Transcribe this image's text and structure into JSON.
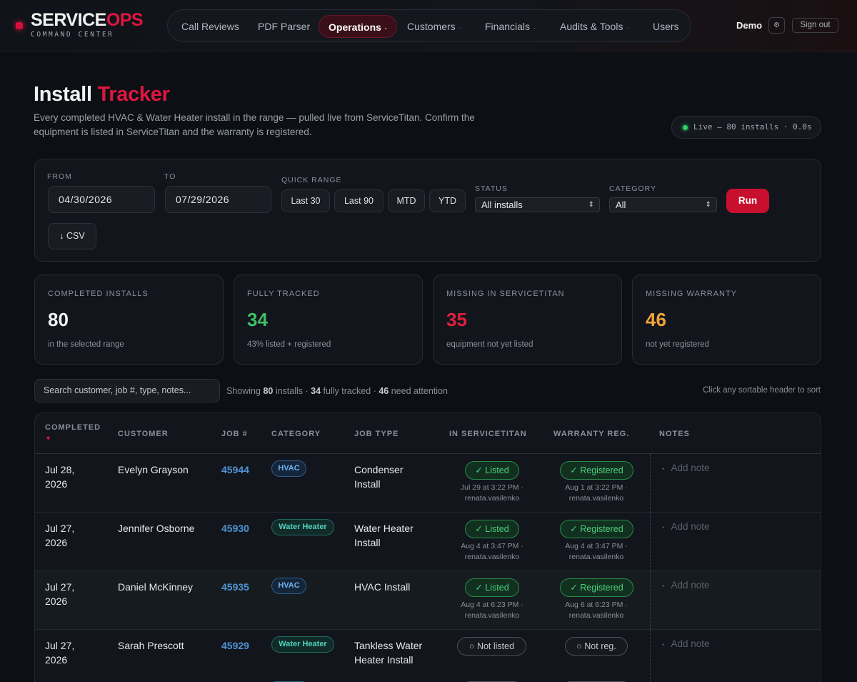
{
  "brand": {
    "name_main": "SERVICE",
    "name_accent": "OPS",
    "subtitle": "COMMAND CENTER"
  },
  "nav": [
    {
      "label": "Call Reviews",
      "caret": ""
    },
    {
      "label": "PDF Parser",
      "caret": ""
    },
    {
      "label": "Operations",
      "caret": "·",
      "active": true
    },
    {
      "label": "Customers",
      "caret": "·"
    },
    {
      "label": "Financials",
      "caret": "·"
    },
    {
      "label": "Audits & Tools",
      "caret": "·"
    },
    {
      "label": "Users",
      "caret": ""
    }
  ],
  "user": {
    "name": "Demo",
    "settings_icon": "⚙",
    "signout_label": "Sign out"
  },
  "page": {
    "title_main": "Install ",
    "title_accent": "Tracker",
    "description": "Every completed HVAC & Water Heater install in the range — pulled live from ServiceTitan. Confirm the equipment is listed in ServiceTitan and the warranty is registered.",
    "live_status": "Live — 80 installs · 0.0s"
  },
  "filters": {
    "from_label": "FROM",
    "from_value": "04/30/2026",
    "to_label": "TO",
    "to_value": "07/29/2026",
    "quick_range_label": "QUICK RANGE",
    "quick_ranges": [
      "Last 30",
      "Last 90",
      "MTD",
      "YTD"
    ],
    "status_label": "STATUS",
    "status_value": "All installs",
    "category_label": "CATEGORY",
    "category_value": "All",
    "run_label": "Run",
    "csv_label": "↓ CSV"
  },
  "stats": [
    {
      "label": "COMPLETED INSTALLS",
      "value": "80",
      "sub": "in the selected range",
      "color": "#f0f1f3"
    },
    {
      "label": "FULLY TRACKED",
      "value": "34",
      "sub": "43% listed + registered",
      "color": "#3fbf68"
    },
    {
      "label": "MISSING IN SERVICETITAN",
      "value": "35",
      "sub": "equipment not yet listed",
      "color": "#e0203f"
    },
    {
      "label": "MISSING WARRANTY",
      "value": "46",
      "sub": "not yet registered",
      "color": "#f0a53a"
    }
  ],
  "search": {
    "placeholder": "Search customer, job #, type, notes..."
  },
  "summary": {
    "prefix": "Showing ",
    "installs": "80",
    "mid1": " installs · ",
    "tracked": "34",
    "mid2": " fully tracked · ",
    "attention": "46",
    "suffix": " need attention"
  },
  "sort_hint": "Click any sortable header to sort",
  "table": {
    "headers": [
      "COMPLETED",
      "CUSTOMER",
      "JOB #",
      "CATEGORY",
      "JOB TYPE",
      "IN SERVICETITAN",
      "WARRANTY REG.",
      "NOTES"
    ],
    "sort_indicator": "▼",
    "add_note_label": "Add note",
    "rows": [
      {
        "date_line1": "Jul 28,",
        "date_line2": "2026",
        "customer": "Evelyn Grayson",
        "job": "45944",
        "category": "HVAC",
        "type_line1": "Condenser",
        "type_line2": "Install",
        "st_label": "✓  Listed",
        "st_ok": true,
        "st_meta1": "Jul 29 at 3:22 PM ·",
        "st_meta2": "renata.vasilenko",
        "wr_label": "✓  Registered",
        "wr_ok": true,
        "wr_meta1": "Aug 1 at 3:22 PM ·",
        "wr_meta2": "renata.vasilenko"
      },
      {
        "date_line1": "Jul 27,",
        "date_line2": "2026",
        "customer": "Jennifer Osborne",
        "job": "45930",
        "category": "Water Heater",
        "type_line1": "Water Heater",
        "type_line2": "Install",
        "st_label": "✓  Listed",
        "st_ok": true,
        "st_meta1": "Aug 4 at 3:47 PM ·",
        "st_meta2": "renata.vasilenko",
        "wr_label": "✓  Registered",
        "wr_ok": true,
        "wr_meta1": "Aug 4 at 3:47 PM ·",
        "wr_meta2": "renata.vasilenko"
      },
      {
        "date_line1": "Jul 27,",
        "date_line2": "2026",
        "customer": "Daniel McKinney",
        "job": "45935",
        "category": "HVAC",
        "type_line1": "HVAC Install",
        "type_line2": "",
        "st_label": "✓  Listed",
        "st_ok": true,
        "st_meta1": "Aug 4 at 6:23 PM ·",
        "st_meta2": "renata.vasilenko",
        "wr_label": "✓  Registered",
        "wr_ok": true,
        "wr_meta1": "Aug 6 at 6:23 PM ·",
        "wr_meta2": "renata.vasilenko"
      },
      {
        "date_line1": "Jul 27,",
        "date_line2": "2026",
        "customer": "Sarah Prescott",
        "job": "45929",
        "category": "Water Heater",
        "type_line1": "Tankless Water",
        "type_line2": "Heater Install",
        "st_label": "○  Not listed",
        "st_ok": false,
        "st_meta1": "",
        "st_meta2": "",
        "wr_label": "○  Not reg.",
        "wr_ok": false,
        "wr_meta1": "",
        "wr_meta2": ""
      }
    ]
  }
}
